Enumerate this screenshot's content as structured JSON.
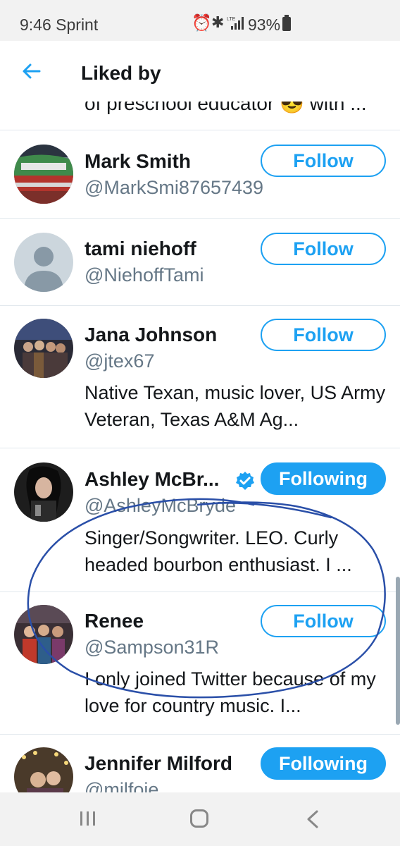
{
  "status_bar": {
    "time": "9:46 Sprint",
    "battery": "93%",
    "icons": [
      "alarm-icon",
      "bluetooth-icon",
      "lte-signal-icon",
      "battery-icon"
    ]
  },
  "header": {
    "title": "Liked by",
    "back_icon": "arrow-left-icon"
  },
  "partial_bio": "of preschool educator 😎 with ...",
  "users": [
    {
      "name": "Mark Smith",
      "handle": "@MarkSmi87657439",
      "bio": "",
      "button": "Follow",
      "following": false
    },
    {
      "name": "tami niehoff",
      "handle": "@NiehoffTami",
      "bio": "",
      "button": "Follow",
      "following": false
    },
    {
      "name": "Jana Johnson",
      "handle": "@jtex67",
      "bio": "Native Texan, music lover, US Army Veteran, Texas A&M Ag...",
      "button": "Follow",
      "following": false
    },
    {
      "name": "Ashley McBr...",
      "handle": "@AshleyMcBryde",
      "bio": "Singer/Songwriter. LEO. Curly headed bourbon enthusiast. I ...",
      "button": "Following",
      "following": true,
      "verified": true
    },
    {
      "name": "Renee",
      "handle": "@Sampson31R",
      "bio": "I only joined Twitter because of my love for country music. I...",
      "button": "Follow",
      "following": false
    },
    {
      "name": "Jennifer Milford",
      "handle": "@milfoie",
      "bio": "",
      "button": "Following",
      "following": true
    }
  ],
  "colors": {
    "accent": "#1da1f2",
    "annotation_ink": "#2a4fa8",
    "text": "#14171a",
    "secondary_text": "#657786"
  },
  "nav_bar": {
    "icons": [
      "recents-icon",
      "home-icon",
      "back-icon"
    ]
  }
}
